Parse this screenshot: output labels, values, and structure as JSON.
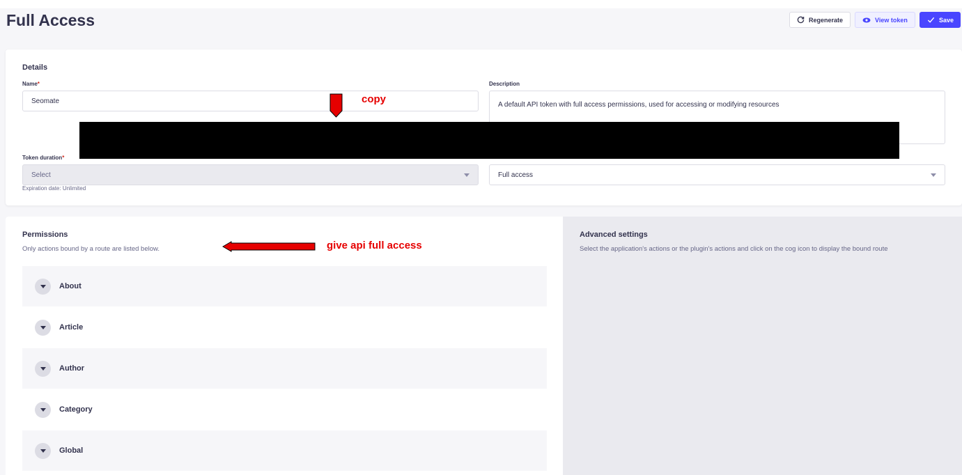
{
  "header": {
    "title": "Full Access",
    "regenerate_label": "Regenerate",
    "view_token_label": "View token",
    "save_label": "Save"
  },
  "details": {
    "section_title": "Details",
    "name_label": "Name",
    "name_value": "Seomate",
    "description_label": "Description",
    "description_value": "A default API token with full access permissions, used for accessing or modifying resources",
    "token_duration_label": "Token duration",
    "token_duration_value": "Select",
    "expiration_hint": "Expiration date: Unlimited",
    "token_type_value": "Full access"
  },
  "permissions": {
    "title": "Permissions",
    "subtitle": "Only actions bound by a route are listed below.",
    "items": [
      {
        "label": "About"
      },
      {
        "label": "Article"
      },
      {
        "label": "Author"
      },
      {
        "label": "Category"
      },
      {
        "label": "Global"
      }
    ]
  },
  "advanced": {
    "title": "Advanced settings",
    "subtitle": "Select the application's actions or the plugin's actions and click on the cog icon to display the bound route"
  },
  "annotations": {
    "copy": "copy",
    "full_access": "give api full access",
    "color": "#e60000"
  },
  "colors": {
    "primary": "#4945ff",
    "required": "#d02b20"
  }
}
